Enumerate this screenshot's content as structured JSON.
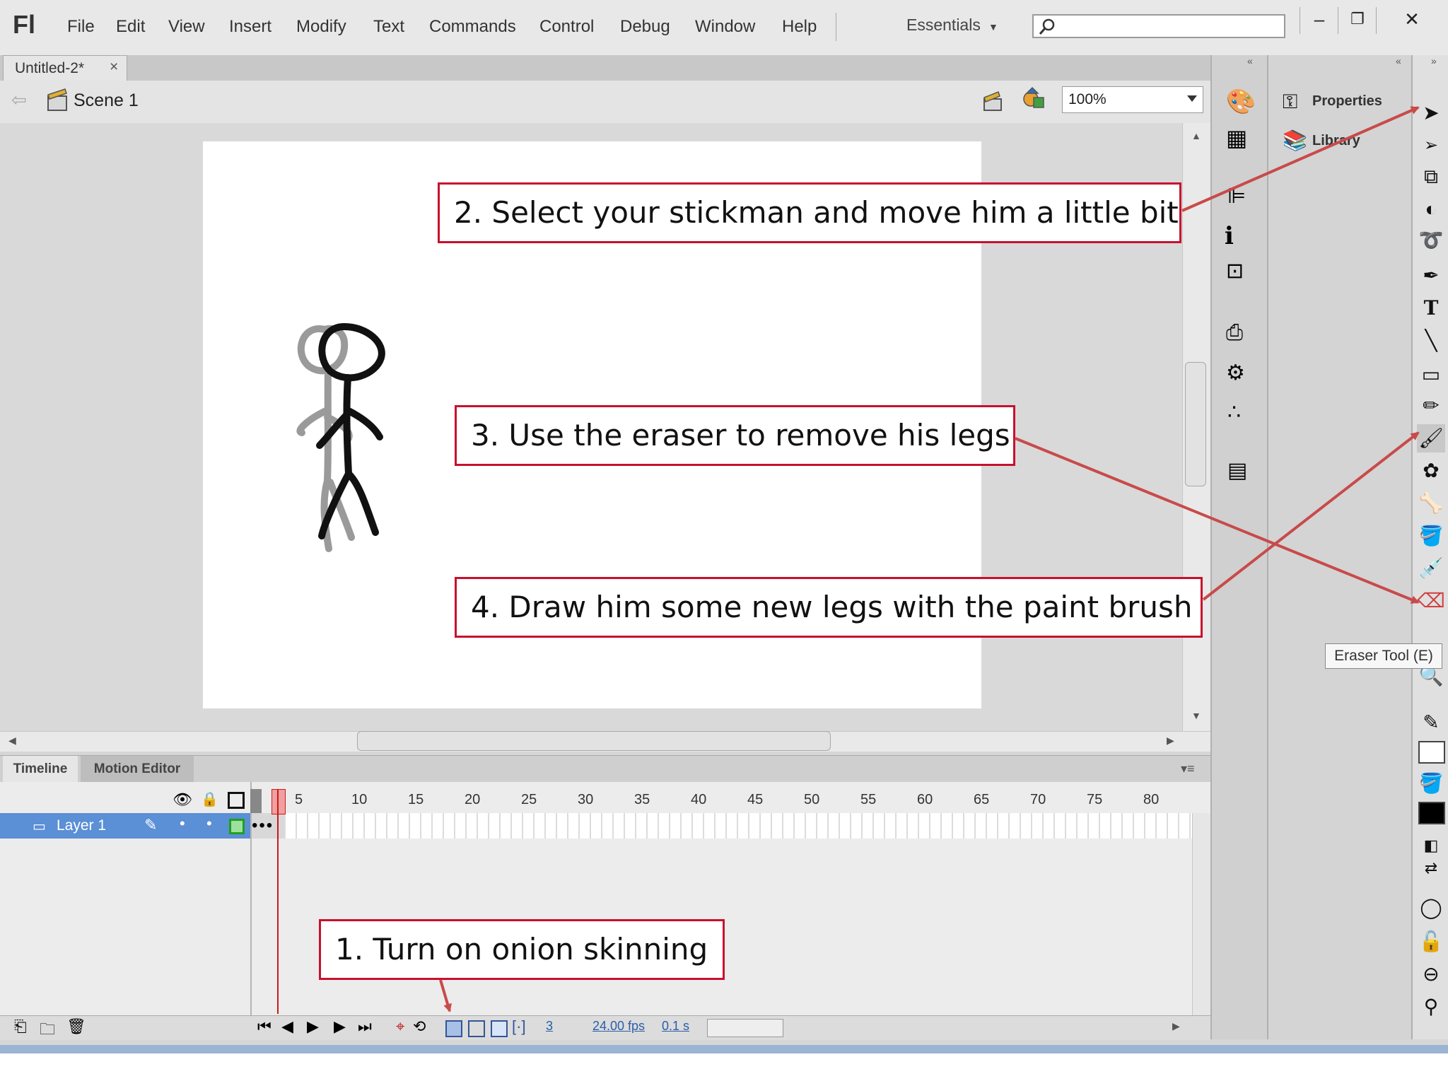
{
  "app": {
    "logo": "Fl",
    "menu": [
      "File",
      "Edit",
      "View",
      "Insert",
      "Modify",
      "Text",
      "Commands",
      "Control",
      "Debug",
      "Window",
      "Help"
    ],
    "workspace": "Essentials"
  },
  "document": {
    "tab": "Untitled-2*",
    "tab_close": "×",
    "scene": "Scene 1",
    "zoom": "100%"
  },
  "callouts": {
    "step2": "2. Select your stickman and move him a little bit",
    "step3": "3. Use the eraser to remove his legs",
    "step4": "4. Draw him some new legs with the paint brush",
    "step1": "1. Turn on onion skinning"
  },
  "colors": {
    "callout_border": "#c8102e",
    "arrow": "#c94a4a",
    "layer_selected": "#5b8fd6"
  },
  "timeline": {
    "tabs": [
      "Timeline",
      "Motion Editor"
    ],
    "ruler": [
      "5",
      "10",
      "15",
      "20",
      "25",
      "30",
      "35",
      "40",
      "45",
      "50",
      "55",
      "60",
      "65",
      "70",
      "75",
      "80"
    ],
    "layer_name": "Layer 1",
    "current_frame": "3",
    "fps": "24.00 fps",
    "time": "0.1 s"
  },
  "panels": {
    "properties": "Properties",
    "library": "Library"
  },
  "tooltip": "Eraser Tool (E)"
}
